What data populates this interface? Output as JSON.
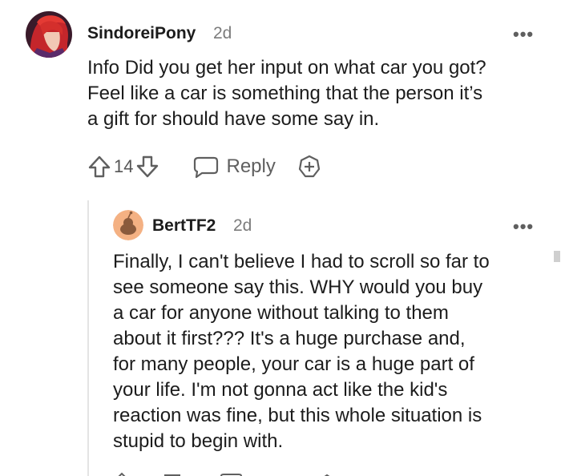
{
  "comments": [
    {
      "username": "SindoreiPony",
      "age": "2d",
      "text": "Info Did you get her input on what car you got?\nFeel like a car is something that the person it’s\na gift for should have some say in.",
      "vote_count": "14",
      "reply_label": "Reply"
    },
    {
      "username": "BertTF2",
      "age": "2d",
      "text": "Finally, I can't believe I had to scroll so far to\nsee someone say this. WHY would you buy\na car for anyone without talking to them\nabout it first??? It's a huge purchase and,\nfor many people, your car is a huge part of\nyour life. I'm not gonna act like the kid's\nreaction was fine, but this whole situation is\nstupid to begin with."
    }
  ],
  "more_glyph": "•••",
  "colors": {
    "text": "#1c1c1c",
    "muted": "#7c7c7c",
    "icon": "#5f5f5f",
    "avatar_orange": "#f4b183"
  }
}
